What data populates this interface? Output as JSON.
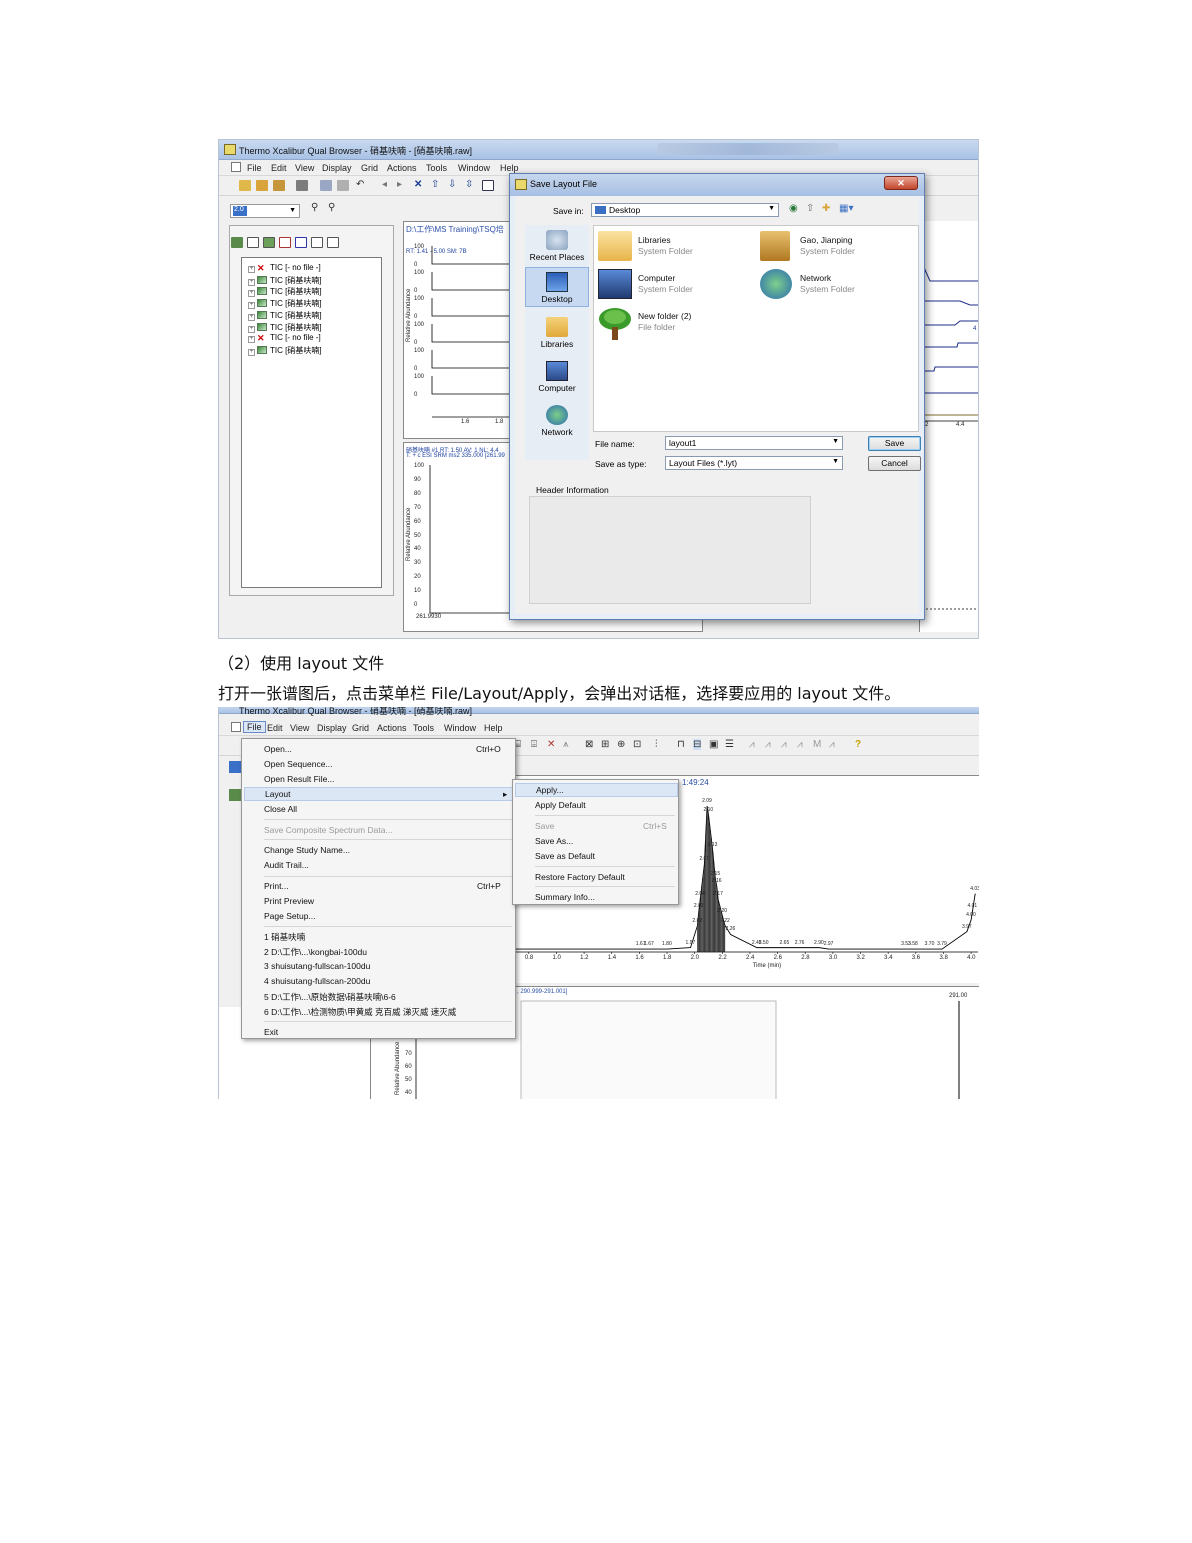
{
  "screenshot1": {
    "window_title": "Thermo Xcalibur Qual Browser - 硝基呋喃 - [硝基呋喃.raw]",
    "menu": [
      "File",
      "Edit",
      "View",
      "Display",
      "Grid",
      "Actions",
      "Tools",
      "Window",
      "Help"
    ],
    "combo_value": "2.0",
    "tree_items": [
      {
        "icon": "x",
        "label": "TIC [- no file -]"
      },
      {
        "icon": "chart",
        "label": "TIC [硝基呋喃]"
      },
      {
        "icon": "chart",
        "label": "TIC [硝基呋喃]"
      },
      {
        "icon": "chart",
        "label": "TIC [硝基呋喃]"
      },
      {
        "icon": "chart",
        "label": "TIC [硝基呋喃]"
      },
      {
        "icon": "chart",
        "label": "TIC [硝基呋喃]"
      },
      {
        "icon": "x",
        "label": "TIC [- no file -]"
      },
      {
        "icon": "chart",
        "label": "TIC [硝基呋喃]"
      }
    ],
    "chart_path": "D:\\工作\\MS Training\\TSQ培",
    "chart_header": "RT: 1.41 - 5.00   SM: 7B",
    "chart2_header1": "硝基呋喃 #1  RT: 1.50  AV: 1  NL: 4.4",
    "chart2_header2": "T: + c ESI SRM ms2 335.000 [261.99",
    "x_ticks_top": [
      "1.6",
      "1.8"
    ],
    "y_ticks_top": [
      "100",
      "0"
    ],
    "y_ticks_bottom": [
      "100",
      "90",
      "80",
      "70",
      "60",
      "50",
      "40",
      "30",
      "20",
      "10",
      "0"
    ],
    "x_start_bottom": "261.9930",
    "y_axis_label": "Relative Abundance",
    "right_ticks": [
      "4.2",
      "4.4"
    ],
    "right_peak_labels": [
      "5",
      "4"
    ],
    "dialog": {
      "title": "Save Layout File",
      "save_in_label": "Save in:",
      "save_in_value": "Desktop",
      "places": [
        "Recent Places",
        "Desktop",
        "Libraries",
        "Computer",
        "Network"
      ],
      "files": [
        {
          "name": "Libraries",
          "sub": "System Folder"
        },
        {
          "name": "Gao, Jianping",
          "sub": "System Folder"
        },
        {
          "name": "Computer",
          "sub": "System Folder"
        },
        {
          "name": "Network",
          "sub": "System Folder"
        },
        {
          "name": "New folder (2)",
          "sub": "File folder"
        }
      ],
      "file_name_label": "File name:",
      "file_name_value": "layout1",
      "save_type_label": "Save as type:",
      "save_type_value": "Layout Files (*.lyt)",
      "save_button": "Save",
      "cancel_button": "Cancel",
      "header_info_label": "Header Information"
    }
  },
  "text": {
    "line1": "（2）使用 layout 文件",
    "line2": "打开一张谱图后，点击菜单栏 File/Layout/Apply，会弹出对话框，选择要应用的 layout 文件。"
  },
  "screenshot2": {
    "window_title": "Thermo Xcalibur Qual Browser - 硝基呋喃 - [硝基呋喃.raw]",
    "menu": [
      "File",
      "Edit",
      "View",
      "Display",
      "Grid",
      "Actions",
      "Tools",
      "Window",
      "Help"
    ],
    "file_menu": [
      {
        "label": "Open...",
        "shortcut": "Ctrl+O"
      },
      {
        "label": "Open Sequence..."
      },
      {
        "label": "Open Result File..."
      },
      {
        "label": "Layout",
        "submenu": true
      },
      {
        "label": "Close All"
      },
      {
        "label": "Save Composite Spectrum Data...",
        "disabled": true
      },
      {
        "label": "Change Study Name..."
      },
      {
        "label": "Audit Trail..."
      },
      {
        "label": "Print...",
        "shortcut": "Ctrl+P"
      },
      {
        "label": "Print Preview"
      },
      {
        "label": "Page Setup..."
      },
      {
        "label": "1 硝基呋喃"
      },
      {
        "label": "2 D:\\工作\\...\\kongbai-100du"
      },
      {
        "label": "3 shuisutang-fullscan-100du"
      },
      {
        "label": "4 shuisutang-fullscan-200du"
      },
      {
        "label": "5 D:\\工作\\...\\原始数据\\硝基呋喃\\6-6"
      },
      {
        "label": "6 D:\\工作\\...\\检测物质\\甲黄威 克百威 涕灭威 速灭威"
      },
      {
        "label": "Exit"
      }
    ],
    "layout_submenu": [
      {
        "label": "Apply..."
      },
      {
        "label": "Apply Default"
      },
      {
        "label": "Save",
        "shortcut": "Ctrl+S",
        "disabled": true
      },
      {
        "label": "Save As..."
      },
      {
        "label": "Save as Default"
      },
      {
        "label": "Restore Factory Default"
      },
      {
        "label": "Summary Info..."
      }
    ],
    "time_label": "1:49:24",
    "mass_range": ", 290.999-291.001]",
    "peak_mass": "291.00",
    "x_axis_title": "Time (min)",
    "x_ticks": [
      "0.8",
      "1.0",
      "1.2",
      "1.4",
      "1.6",
      "1.8",
      "2.0",
      "2.2",
      "2.4",
      "2.6",
      "2.8",
      "3.0",
      "3.2",
      "3.4",
      "3.6",
      "3.8",
      "4.0"
    ],
    "y_ticks_lower": [
      "70",
      "60",
      "50",
      "40"
    ],
    "y_axis_label": "Relative Abundance",
    "peak_labels": [
      "2.09",
      "2.10",
      "2.07",
      "2.13",
      "2.15",
      "2.16",
      "2.04",
      "2.17",
      "2.03",
      "2.20",
      "2.02",
      "2.22",
      "1.97",
      "2.26",
      "1.61",
      "1.67",
      "1.80",
      "2.45",
      "2.50",
      "2.65",
      "2.76",
      "2.90",
      "2.97",
      "3.53",
      "3.58",
      "3.70",
      "3.79",
      "4.03",
      "4.01",
      "4.00",
      "3.97"
    ]
  },
  "chart_data": {
    "type": "line",
    "title": "",
    "xlabel": "Time (min)",
    "ylabel": "Relative Abundance",
    "x": [
      1.61,
      1.67,
      1.8,
      1.97,
      2.02,
      2.03,
      2.04,
      2.07,
      2.09,
      2.1,
      2.13,
      2.15,
      2.16,
      2.17,
      2.2,
      2.22,
      2.26,
      2.45,
      2.5,
      2.65,
      2.76,
      2.9,
      2.97,
      3.53,
      3.58,
      3.7,
      3.79,
      3.97,
      4.0,
      4.01,
      4.03
    ],
    "series": [
      {
        "values": [
          2,
          2,
          2,
          3,
          18,
          28,
          36,
          60,
          100,
          94,
          70,
          50,
          45,
          36,
          25,
          18,
          12,
          3,
          3,
          3,
          3,
          3,
          2,
          2,
          2,
          2,
          2,
          14,
          22,
          28,
          40
        ]
      }
    ],
    "xlim": [
      0.7,
      4.05
    ],
    "ylim": [
      0,
      100
    ]
  }
}
